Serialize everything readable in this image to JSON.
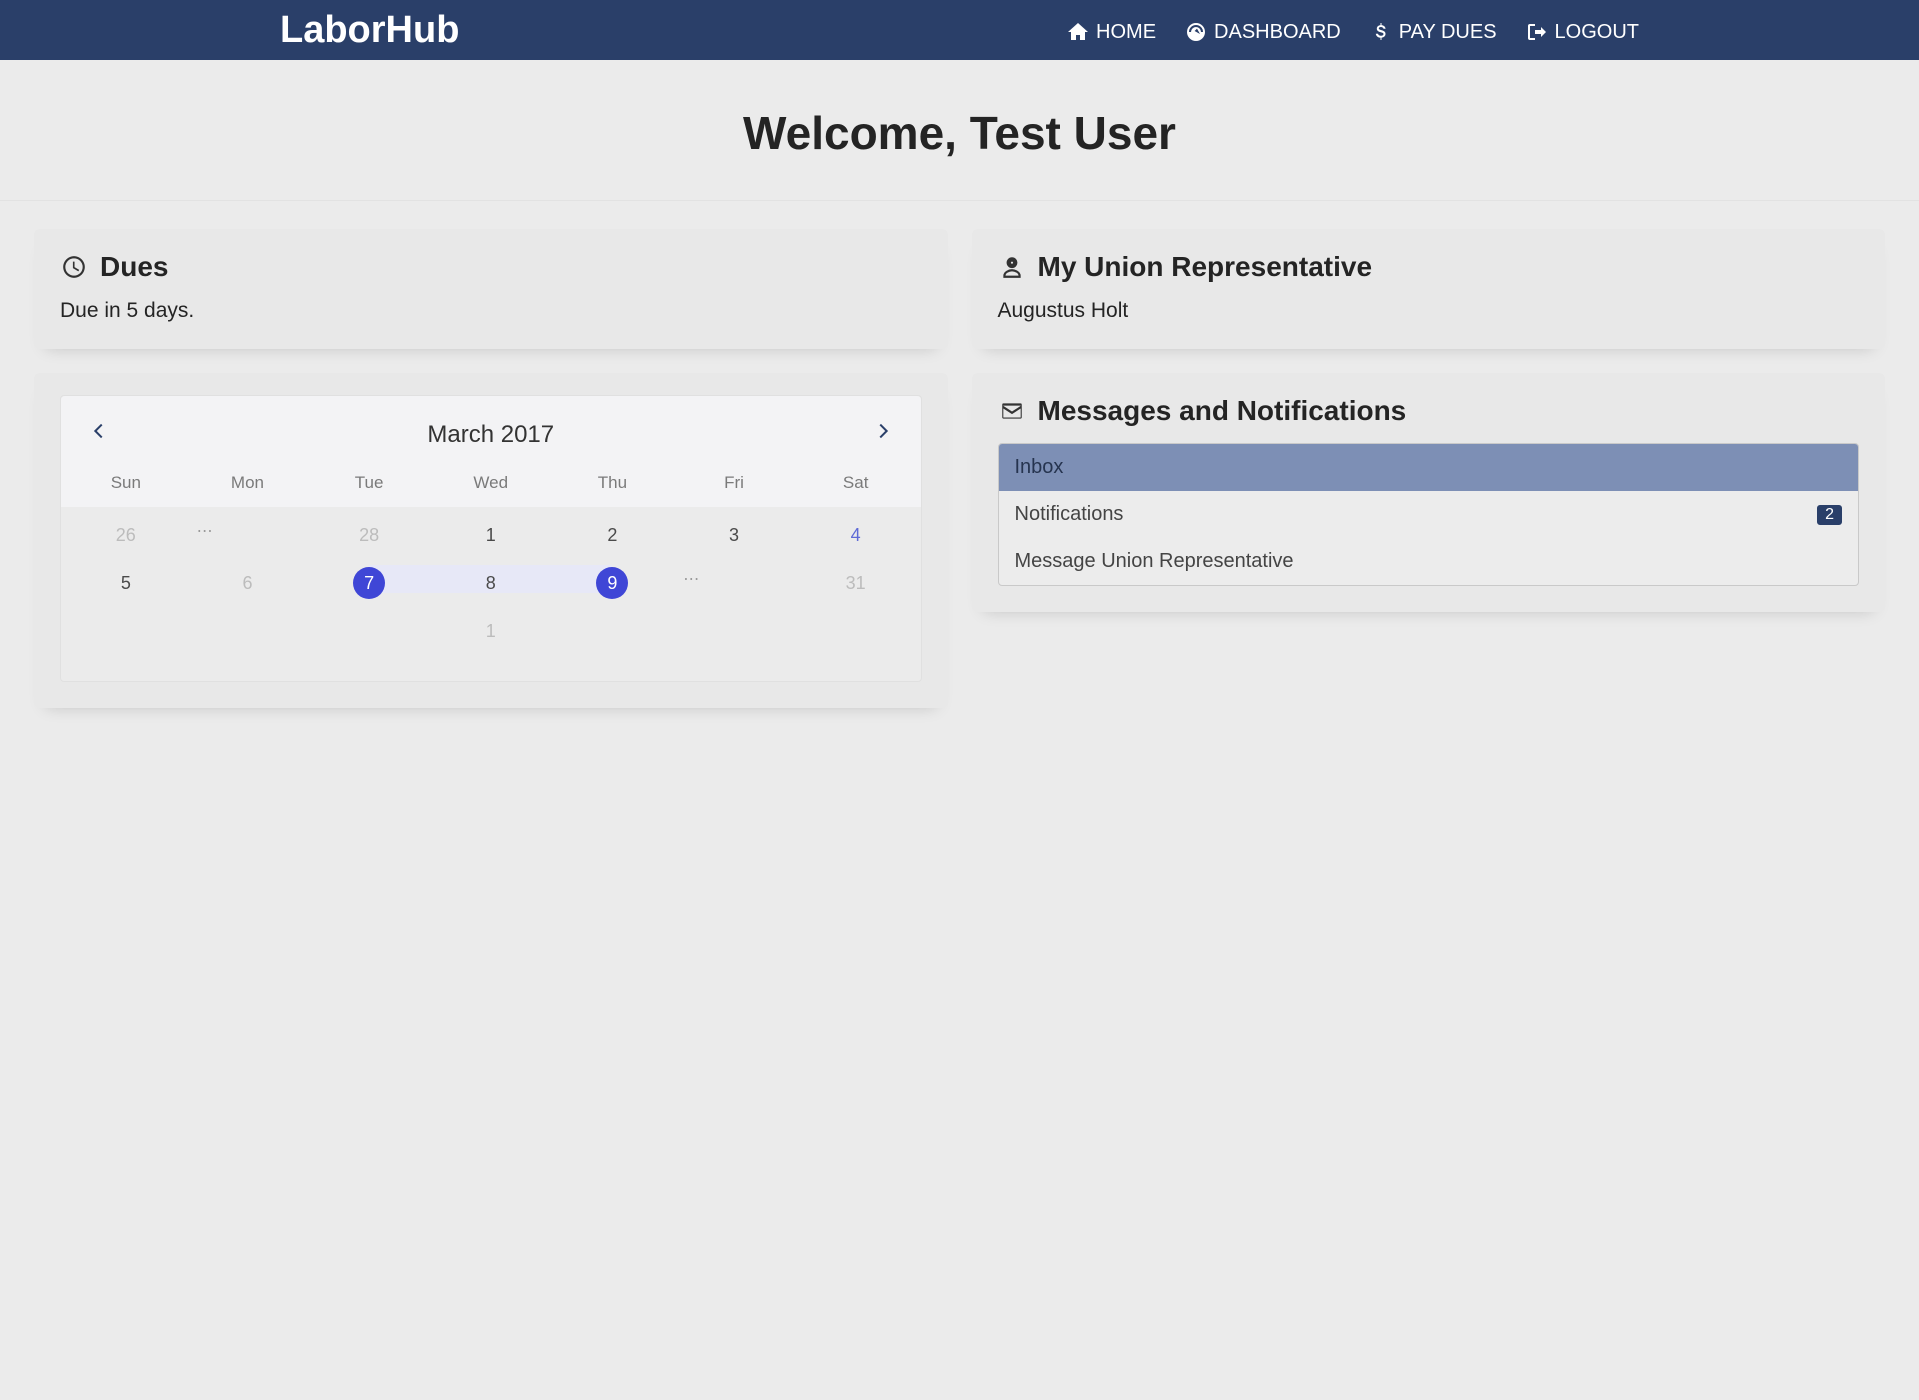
{
  "brand": "LaborHub",
  "nav": {
    "home": "HOME",
    "dashboard": "DASHBOARD",
    "paydues": "PAY DUES",
    "logout": "LOGOUT"
  },
  "welcome": "Welcome, Test User",
  "dues": {
    "title": "Dues",
    "text": "Due in 5 days."
  },
  "rep": {
    "title": "My Union Representative",
    "name": "Augustus Holt"
  },
  "messages": {
    "title": "Messages and Notifications",
    "items": {
      "inbox": "Inbox",
      "notifications": "Notifications",
      "notifications_badge": "2",
      "message_rep": "Message Union Representative"
    }
  },
  "calendar": {
    "title": "March 2017",
    "dow": {
      "sun": "Sun",
      "mon": "Mon",
      "tue": "Tue",
      "wed": "Wed",
      "thu": "Thu",
      "fri": "Fri",
      "sat": "Sat"
    },
    "cells": {
      "r0c0": "26",
      "r0c2": "28",
      "r0c3": "1",
      "r0c4": "2",
      "r0c5": "3",
      "r0c6": "4",
      "r1c0": "5",
      "r1c1": "6",
      "r1c2": "7",
      "r1c3": "8",
      "r1c4": "9",
      "r1c6": "31",
      "r2c3": "1"
    },
    "ellipsis": "⋯"
  }
}
